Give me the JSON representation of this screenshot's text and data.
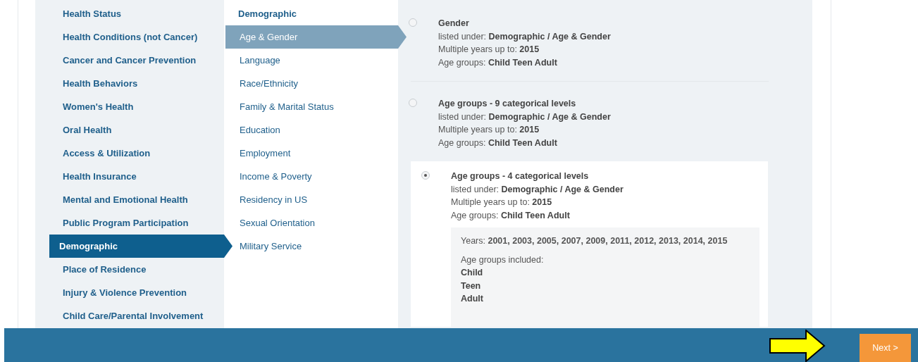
{
  "categories": [
    {
      "label": "Health Status",
      "selected": false
    },
    {
      "label": "Health Conditions (not Cancer)",
      "selected": false
    },
    {
      "label": "Cancer and Cancer Prevention",
      "selected": false
    },
    {
      "label": "Health Behaviors",
      "selected": false
    },
    {
      "label": "Women's Health",
      "selected": false
    },
    {
      "label": "Oral Health",
      "selected": false
    },
    {
      "label": "Access & Utilization",
      "selected": false
    },
    {
      "label": "Health Insurance",
      "selected": false
    },
    {
      "label": "Mental and Emotional Health",
      "selected": false
    },
    {
      "label": "Public Program Participation",
      "selected": false
    },
    {
      "label": "Demographic",
      "selected": true
    },
    {
      "label": "Place of Residence",
      "selected": false
    },
    {
      "label": "Injury & Violence Prevention",
      "selected": false
    },
    {
      "label": "Child Care/Parental Involvement",
      "selected": false
    }
  ],
  "subcategories": {
    "heading": "Demographic",
    "items": [
      {
        "label": "Age & Gender",
        "selected": true
      },
      {
        "label": "Language",
        "selected": false
      },
      {
        "label": "Race/Ethnicity",
        "selected": false
      },
      {
        "label": "Family & Marital Status",
        "selected": false
      },
      {
        "label": "Education",
        "selected": false
      },
      {
        "label": "Employment",
        "selected": false
      },
      {
        "label": "Income & Poverty",
        "selected": false
      },
      {
        "label": "Residency in US",
        "selected": false
      },
      {
        "label": "Sexual Orientation",
        "selected": false
      },
      {
        "label": "Military Service",
        "selected": false
      }
    ]
  },
  "variables": [
    {
      "title": "Gender",
      "selected": false,
      "lines": [
        "listed under: **Demographic / Age & Gender**",
        "Multiple years up to: **2015**",
        "Age groups: **Child Teen Adult**"
      ]
    },
    {
      "title": "Age groups - 9 categorical levels",
      "selected": false,
      "lines": [
        "listed under: **Demographic / Age & Gender**",
        "Multiple years up to: **2015**",
        "Age groups: **Child Teen Adult**"
      ]
    },
    {
      "title": "Age groups - 4 categorical levels",
      "selected": true,
      "lines": [
        "listed under: **Demographic / Age & Gender**",
        "Multiple years up to: **2015**",
        "Age groups: **Child Teen Adult**"
      ],
      "details": {
        "years": "Years: **2001, 2003, 2005, 2007, 2009, 2011, 2012, 2013, 2014, 2015**",
        "age_groups_label": "Age groups included:",
        "age_groups": [
          "Child",
          "Teen",
          "Adult"
        ]
      }
    }
  ],
  "footer": {
    "next_button": "Next >"
  }
}
